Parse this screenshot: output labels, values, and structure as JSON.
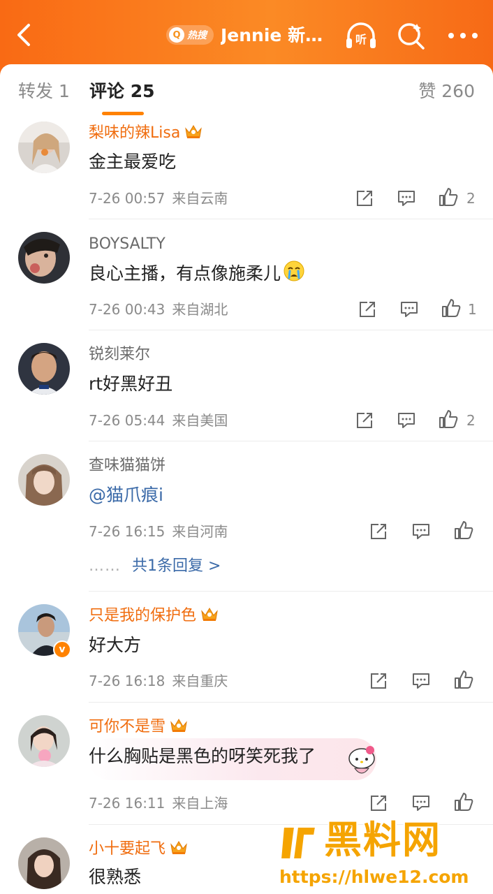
{
  "header": {
    "hot_badge": "热搜",
    "title": "Jennie 新…",
    "accent_color": "#f96a14"
  },
  "tabs": {
    "forward": "转发 1",
    "comment": "评论 25",
    "like": "赞 260",
    "active_color": "#ff8200"
  },
  "comments": [
    {
      "user": "梨味的辣Lisa",
      "vip": true,
      "text": "金主最爱吃",
      "time": "7-26 00:57",
      "location": "来自云南",
      "likes": "2"
    },
    {
      "user": "BOYSALTY",
      "vip": false,
      "text": "良心主播，有点像施柔儿",
      "emoji": "crying-face",
      "time": "7-26 00:43",
      "location": "来自湖北",
      "likes": "1"
    },
    {
      "user": "锐刻莱尔",
      "vip": false,
      "text": "rt好黑好丑",
      "time": "7-26 05:44",
      "location": "来自美国",
      "likes": "2"
    },
    {
      "user": "查味猫猫饼",
      "vip": false,
      "text": "@猫爪痕i",
      "time": "7-26 16:15",
      "location": "来自河南",
      "likes": "",
      "reply_link": "共1条回复 >"
    },
    {
      "user": "只是我的保护色",
      "vip": true,
      "verified": true,
      "text": "好大方",
      "time": "7-26 16:18",
      "location": "来自重庆",
      "likes": ""
    },
    {
      "user": "可你不是雪",
      "vip": true,
      "text": "什么胸贴是黑色的呀笑死我了",
      "time": "7-26 16:11",
      "location": "来自上海",
      "likes": ""
    },
    {
      "user": "小十要起飞",
      "vip": true,
      "text": "很熟悉"
    }
  ],
  "reply_dots": "……",
  "watermark": {
    "title": "黑料网",
    "url": "https://hlwe12.com"
  }
}
